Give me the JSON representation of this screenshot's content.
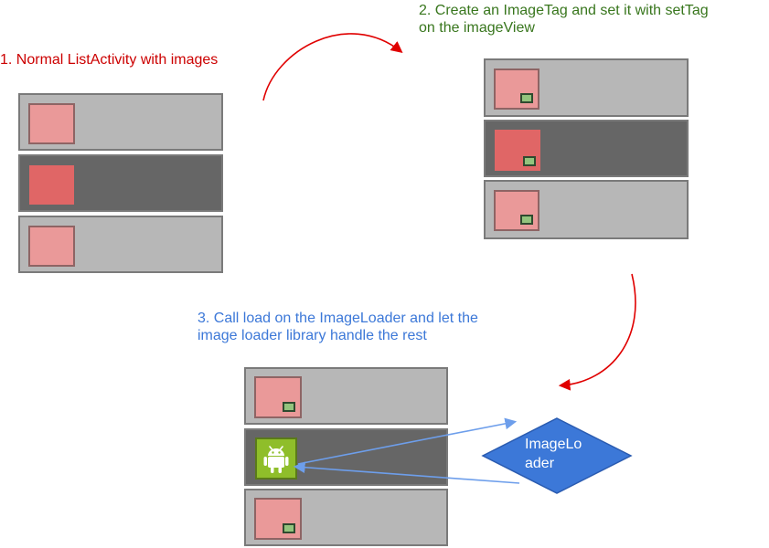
{
  "step1": "1. Normal ListActivity with images",
  "step2": {
    "line1": "2. Create an ImageTag and set it with setTag",
    "line2": "on the imageView"
  },
  "step3": {
    "line1": "3. Call load on the ImageLoader and let the",
    "line2": "image loader library handle the rest"
  },
  "loader": {
    "label": "ImageLoader"
  },
  "colors": {
    "step1": "#cc0000",
    "step2": "#38761d",
    "step3": "#3c78d8",
    "red_arrow": "#e00000",
    "blue_arrow": "#6d9eeb",
    "loader_fill": "#3c78d8",
    "row_light": "#b7b7b7",
    "row_dark": "#666666",
    "thumb_pink": "#ea9999",
    "thumb_red": "#e06666",
    "tag_green": "#93c47d",
    "android_green": "#8fbe2a"
  },
  "icons": {
    "android": "android-icon",
    "tag": "tag-icon"
  }
}
